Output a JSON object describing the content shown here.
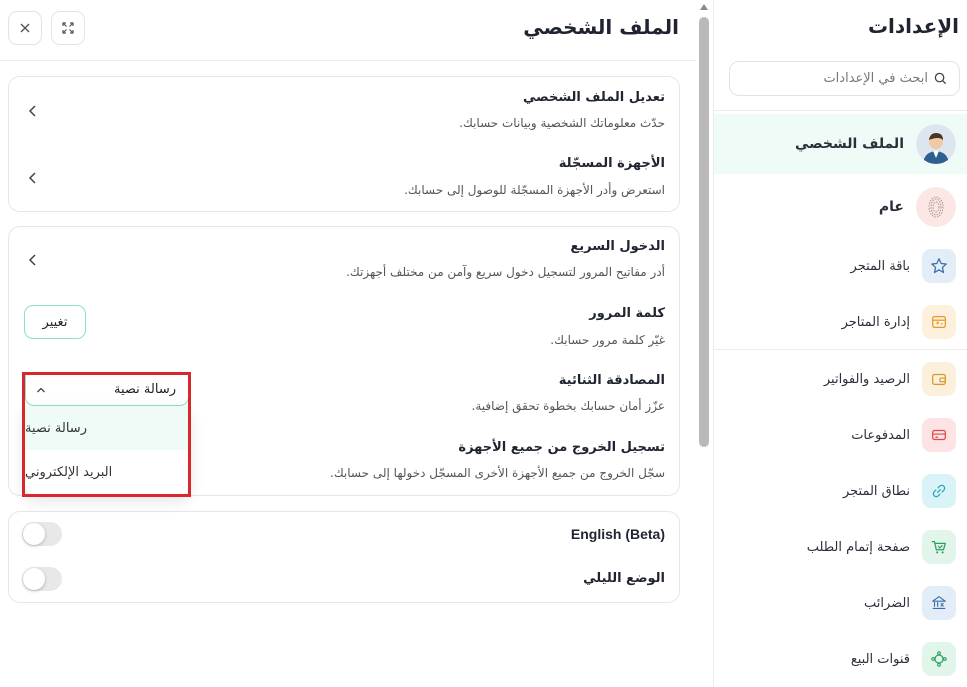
{
  "sidebar": {
    "title": "الإعدادات",
    "search_placeholder": "ابحث في الإعدادات",
    "items": [
      {
        "label": "الملف الشخصي",
        "icon": "user-avatar"
      },
      {
        "label": "عام",
        "icon": "fingerprint-icon"
      },
      {
        "label": "باقة المتجر",
        "icon": "star-icon"
      },
      {
        "label": "إدارة المتاجر",
        "icon": "store-admin-icon"
      },
      {
        "label": "الرصيد والفواتير",
        "icon": "wallet-icon"
      },
      {
        "label": "المدفوعات",
        "icon": "credit-card-icon"
      },
      {
        "label": "نطاق المتجر",
        "icon": "link-icon"
      },
      {
        "label": "صفحة إتمام الطلب",
        "icon": "cart-icon"
      },
      {
        "label": "الضرائب",
        "icon": "bank-icon"
      },
      {
        "label": "قنوات البيع",
        "icon": "channels-icon"
      }
    ]
  },
  "panel": {
    "title": "الملف الشخصي"
  },
  "card1": {
    "edit_profile_title": "تعديل الملف الشخصي",
    "edit_profile_desc": "حدّث معلوماتك الشخصية وبيانات حسابك.",
    "devices_title": "الأجهزة المسجّلة",
    "devices_desc": "استعرض وأدر الأجهزة المسجّلة للوصول إلى حسابك."
  },
  "card2": {
    "quick_login_title": "الدخول السريع",
    "quick_login_desc": "أدر مفاتيح المرور لتسجيل دخول سريع وآمن من مختلف أجهزتك.",
    "password_title": "كلمة المرور",
    "password_desc": "غيّر كلمة مرور حسابك.",
    "change_label": "تغيير",
    "twofa_title": "المصادقة الثنائية",
    "twofa_desc": "عزّز أمان حسابك بخطوة تحقق إضافية.",
    "logout_title": "تسجيل الخروج من جميع الأجهزة",
    "logout_desc": "سجّل الخروج من جميع الأجهزة الأخرى المسجّل دخولها إلى حسابك."
  },
  "dropdown": {
    "selected": "رسالة نصية",
    "options": [
      "رسالة نصية",
      "البريد الإلكتروني"
    ]
  },
  "card3": {
    "english_label": "English (Beta)",
    "english_on": false,
    "dark_mode_label": "الوضع الليلي",
    "dark_mode_on": false
  },
  "colors": {
    "accent": "#8fe0cb",
    "active_bg": "#eefbf7",
    "highlight": "#d9272e"
  }
}
